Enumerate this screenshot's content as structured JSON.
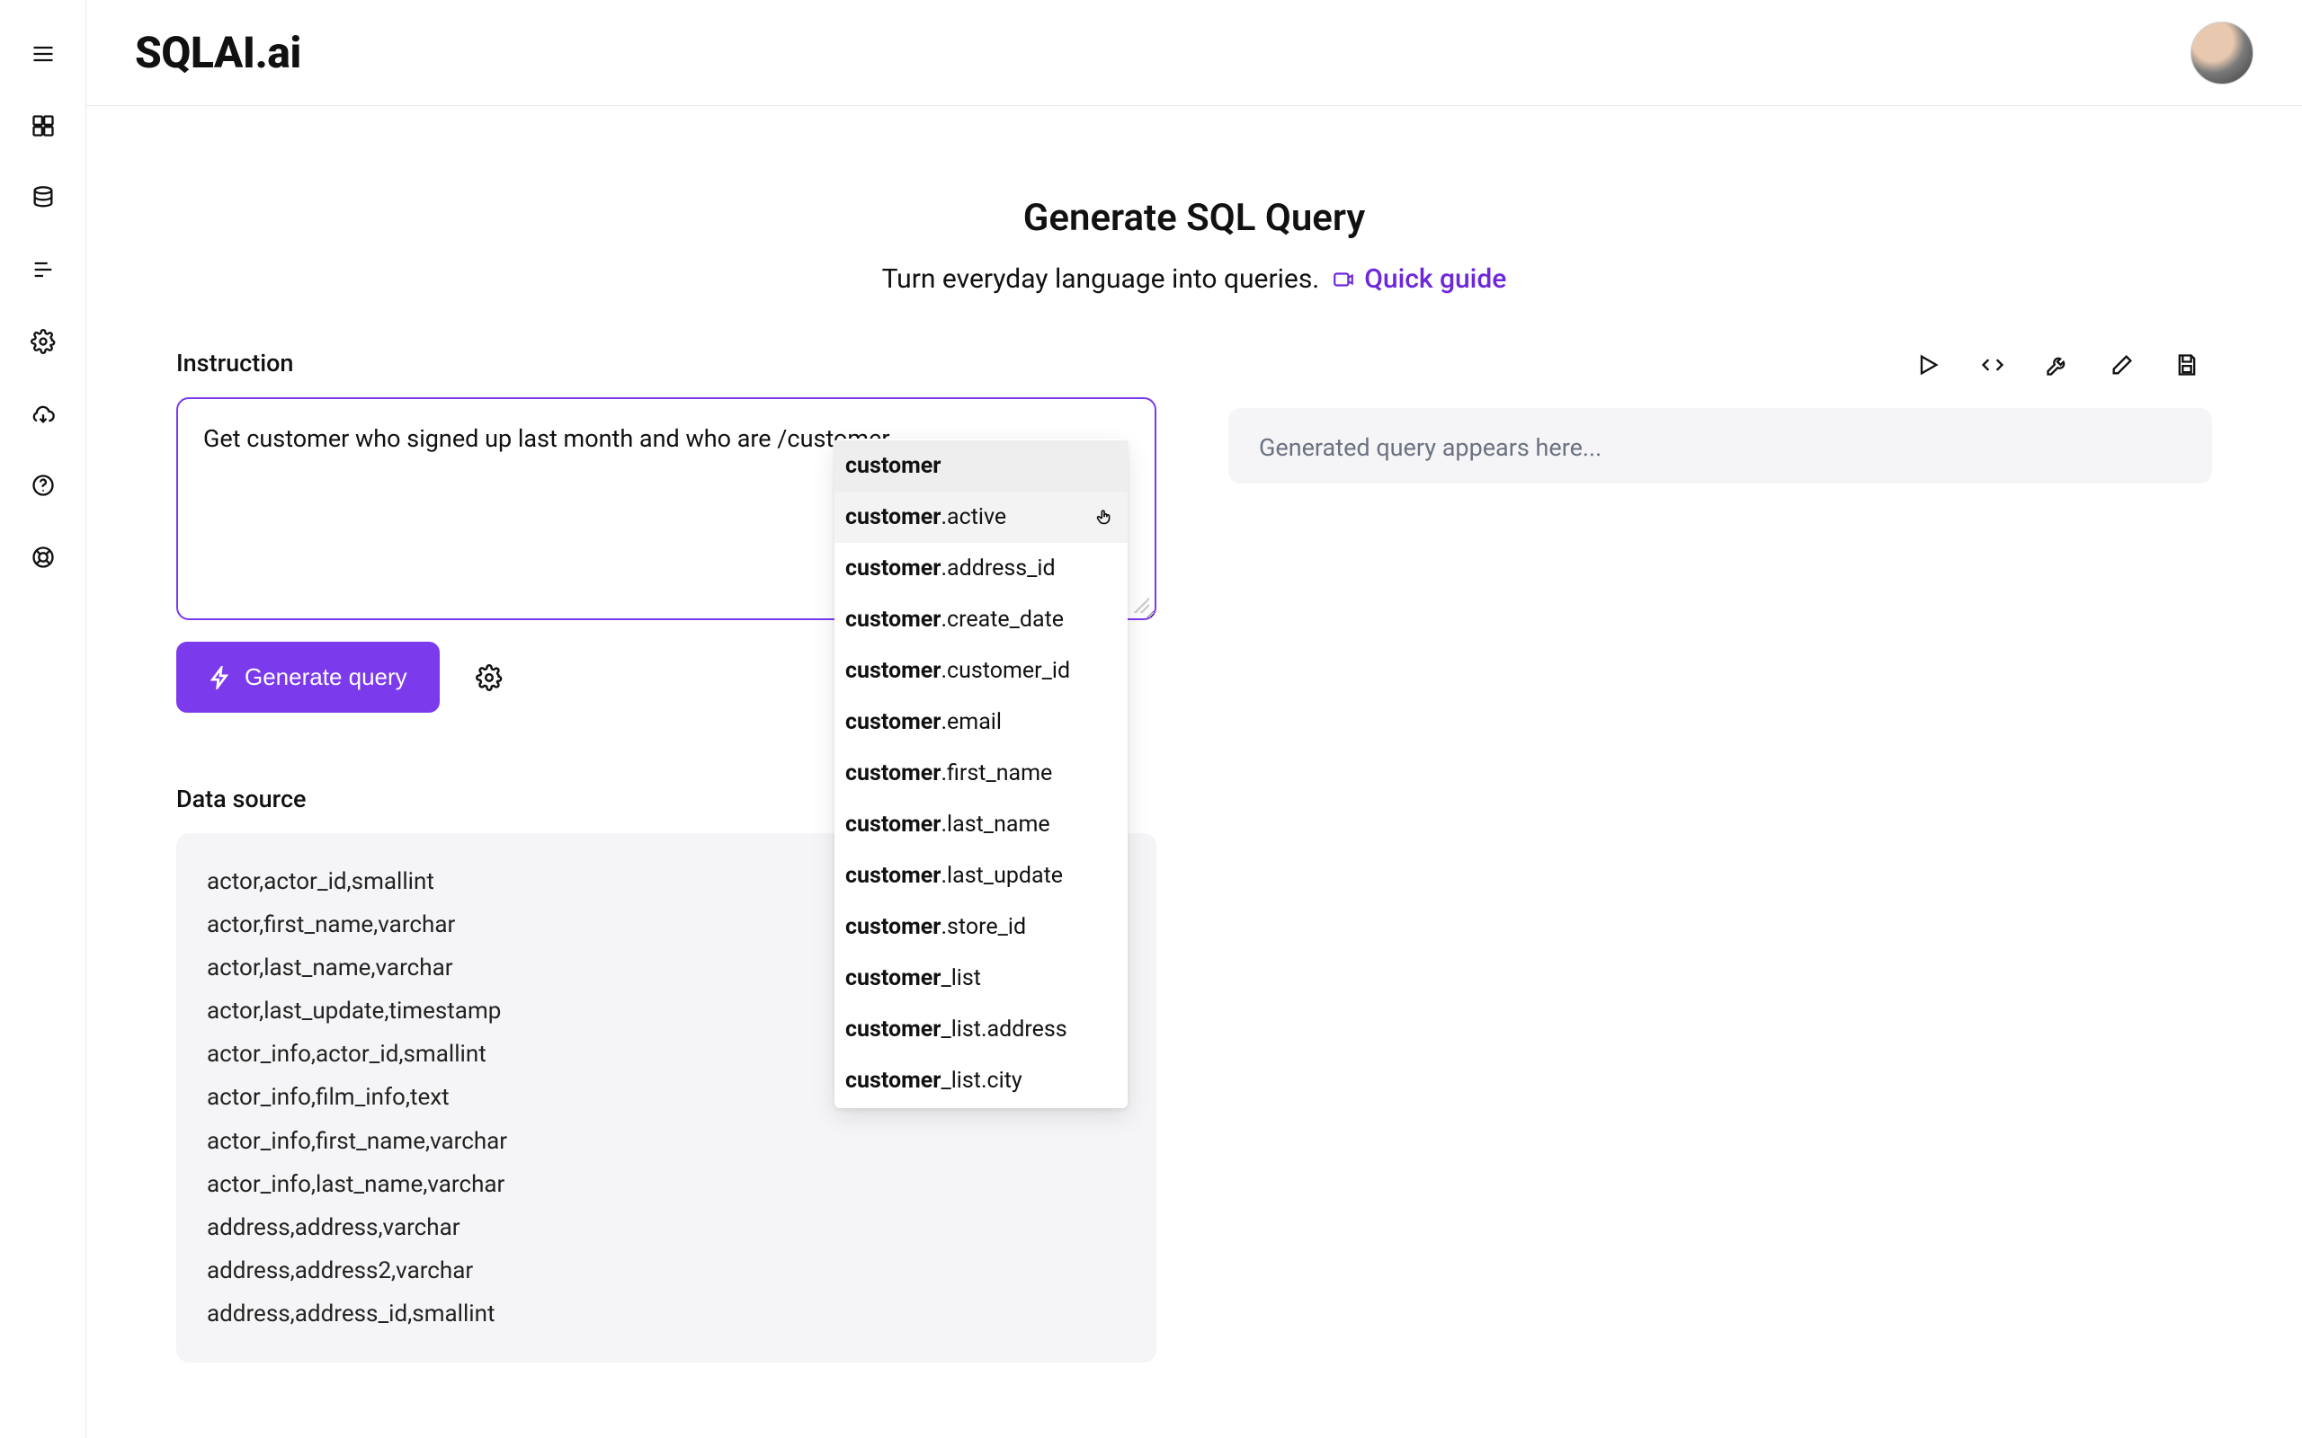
{
  "header": {
    "logo": "SQLAI.ai"
  },
  "hero": {
    "title": "Generate SQL Query",
    "subtitle": "Turn everyday language into queries.",
    "quick_guide_label": "Quick guide"
  },
  "instruction": {
    "label": "Instruction",
    "value": "Get customer who signed up last month and who are /customer"
  },
  "actions": {
    "generate_label": "Generate query"
  },
  "autocomplete": {
    "items": [
      {
        "bold": "customer",
        "rest": ""
      },
      {
        "bold": "customer",
        "rest": ".active"
      },
      {
        "bold": "customer",
        "rest": ".address_id"
      },
      {
        "bold": "customer",
        "rest": ".create_date"
      },
      {
        "bold": "customer",
        "rest": ".customer_id"
      },
      {
        "bold": "customer",
        "rest": ".email"
      },
      {
        "bold": "customer",
        "rest": ".first_name"
      },
      {
        "bold": "customer",
        "rest": ".last_name"
      },
      {
        "bold": "customer",
        "rest": ".last_update"
      },
      {
        "bold": "customer",
        "rest": ".store_id"
      },
      {
        "bold": "customer",
        "rest": "_list"
      },
      {
        "bold": "customer",
        "rest": "_list.address"
      },
      {
        "bold": "customer",
        "rest": "_list.city"
      }
    ],
    "selected_index": 0,
    "hover_index": 1
  },
  "datasource": {
    "label": "Data source",
    "rows": [
      "actor,actor_id,smallint",
      "actor,first_name,varchar",
      "actor,last_name,varchar",
      "actor,last_update,timestamp",
      "actor_info,actor_id,smallint",
      "actor_info,film_info,text",
      "actor_info,first_name,varchar",
      "actor_info,last_name,varchar",
      "address,address,varchar",
      "address,address2,varchar",
      "address,address_id,smallint"
    ]
  },
  "output": {
    "placeholder": "Generated query appears here..."
  },
  "sidebar_icons": [
    "menu",
    "dashboard",
    "database",
    "list",
    "settings",
    "cloud",
    "help",
    "lifebuoy"
  ],
  "right_toolbar_icons": [
    "play",
    "code",
    "wrench",
    "edit",
    "save"
  ]
}
